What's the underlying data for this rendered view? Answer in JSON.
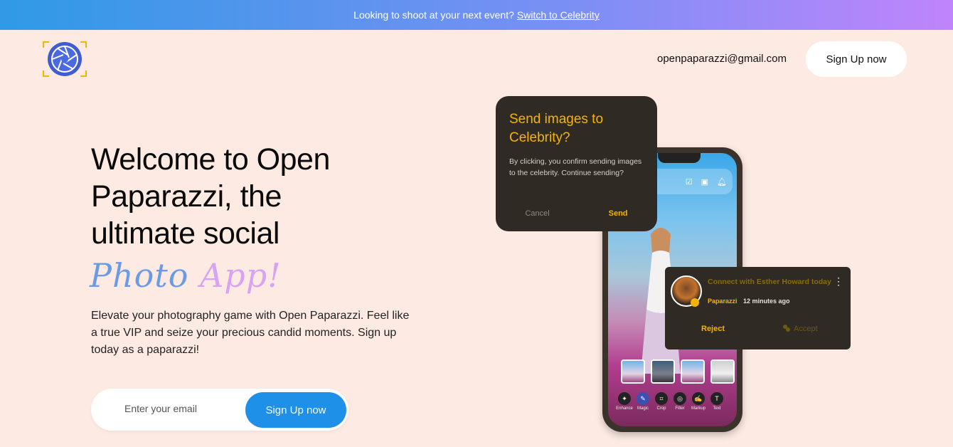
{
  "banner": {
    "text": "Looking to shoot at your next event?",
    "link": "Switch to Celebrity"
  },
  "header": {
    "email": "openpaparazzi@gmail.com",
    "signup_label": "Sign Up now"
  },
  "hero": {
    "title": "Welcome to Open Paparazzi, the ultimate social",
    "script_word1": "Photo",
    "script_word2": "App!",
    "description": "Elevate your photography game with Open Paparazzi. Feel like a true VIP and seize your precious candid moments. Sign up today as a paparazzi!"
  },
  "form": {
    "email_placeholder": "Enter your email",
    "submit_label": "Sign Up now"
  },
  "dialog": {
    "title": "Send images to Celebrity?",
    "body": "By clicking, you confirm sending images to the celebrity. Continue sending?",
    "cancel": "Cancel",
    "send": "Send"
  },
  "notification": {
    "title": "Connect with Esther Howard today",
    "app": "Paparazzi",
    "time": "12 minutes ago",
    "reject": "Reject",
    "accept": "Accept"
  },
  "phone_tools": [
    {
      "icon": "enhance-icon",
      "label": "Enhance"
    },
    {
      "icon": "magic-icon",
      "label": "Magic"
    },
    {
      "icon": "crop-icon",
      "label": "Crop"
    },
    {
      "icon": "filter-icon",
      "label": "Filter"
    },
    {
      "icon": "markup-icon",
      "label": "Markup"
    },
    {
      "icon": "text-icon",
      "label": "Text"
    }
  ],
  "colors": {
    "accent_blue": "#1e90e8",
    "dialog_yellow": "#f5b400",
    "background": "#fdebe3"
  }
}
